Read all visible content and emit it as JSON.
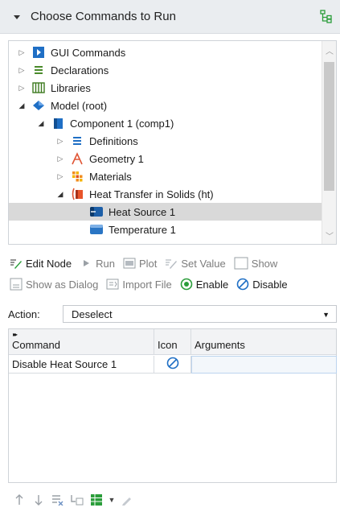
{
  "header": {
    "title": "Choose Commands to Run"
  },
  "tree": {
    "items": [
      {
        "label": "GUI Commands",
        "icon": "gui-commands-icon"
      },
      {
        "label": "Declarations",
        "icon": "declarations-icon"
      },
      {
        "label": "Libraries",
        "icon": "libraries-icon"
      },
      {
        "label": "Model (root)",
        "icon": "model-icon"
      },
      {
        "label": "Component 1 (comp1)",
        "icon": "component-icon"
      },
      {
        "label": "Definitions",
        "icon": "definitions-icon"
      },
      {
        "label": "Geometry 1",
        "icon": "geometry-icon"
      },
      {
        "label": "Materials",
        "icon": "materials-icon"
      },
      {
        "label": "Heat Transfer in Solids (ht)",
        "icon": "heat-transfer-icon"
      },
      {
        "label": "Heat Source 1",
        "icon": "heat-source-icon",
        "selected": true
      },
      {
        "label": "Temperature 1",
        "icon": "temperature-icon"
      }
    ]
  },
  "toolbar": {
    "edit_node": "Edit Node",
    "run": "Run",
    "plot": "Plot",
    "set_value": "Set Value",
    "show": "Show",
    "show_as_dialog": "Show as Dialog",
    "import_file": "Import File",
    "enable": "Enable",
    "disable": "Disable"
  },
  "action": {
    "label": "Action:",
    "value": "Deselect"
  },
  "table": {
    "columns": [
      "Command",
      "Icon",
      "Arguments"
    ],
    "rows": [
      {
        "command": "Disable Heat Source 1",
        "icon": "disable-icon",
        "arguments": ""
      }
    ]
  },
  "colors": {
    "accent": "#1f6fc5",
    "enable": "#2a9d3a",
    "selection": "#d9d9d9"
  }
}
